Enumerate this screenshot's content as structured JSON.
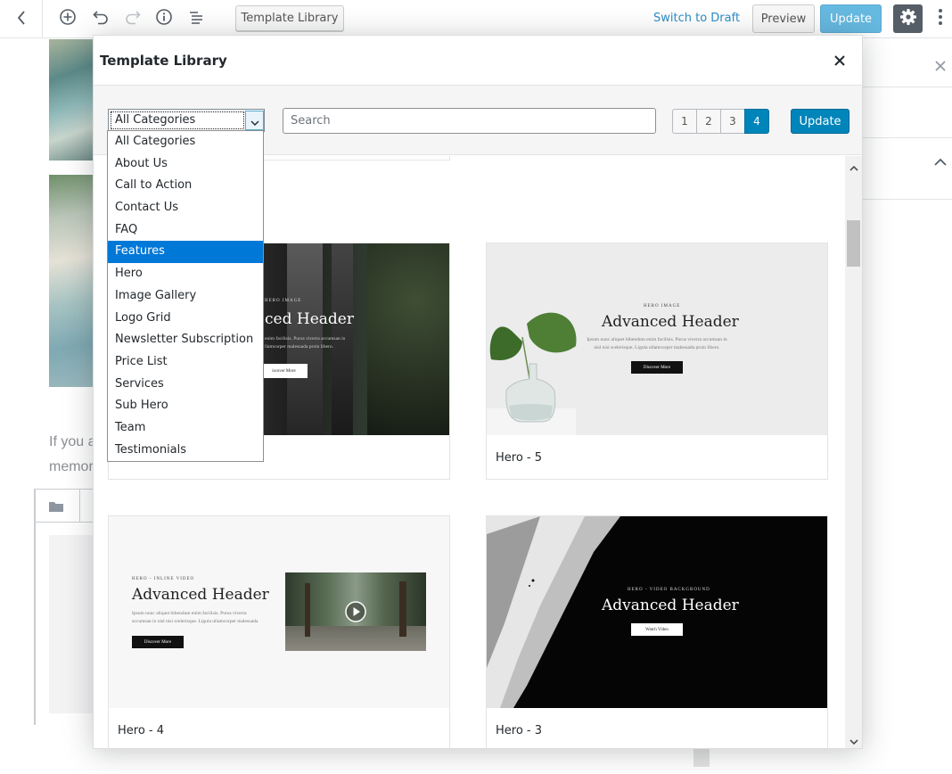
{
  "toolbar": {
    "template_library_label": "Template Library",
    "switch_to_draft_label": "Switch to Draft",
    "preview_label": "Preview",
    "update_label": "Update"
  },
  "background": {
    "paragraph_line1": "If you a",
    "paragraph_line2": "memor"
  },
  "modal": {
    "title": "Template Library",
    "category_select": {
      "value": "All Categories",
      "options": [
        "All Categories",
        "About Us",
        "Call to Action",
        "Contact Us",
        "FAQ",
        "Features",
        "Hero",
        "Image Gallery",
        "Logo Grid",
        "Newsletter Subscription",
        "Price List",
        "Services",
        "Sub Hero",
        "Team",
        "Testimonials"
      ],
      "highlighted": "Features"
    },
    "search_placeholder": "Search",
    "pages": [
      "1",
      "2",
      "3",
      "4"
    ],
    "active_page": "4",
    "update_label": "Update",
    "templates": [
      {
        "label": "",
        "thumb": {
          "kicker": "HERO IMAGE",
          "heading": "ced Header",
          "body_line1": "enim facilisis. Purus viverra accumsan in",
          "body_line2": "llamcorper malesuada proin libero.",
          "button": "iscover More"
        }
      },
      {
        "label": "Hero - 5",
        "thumb": {
          "kicker": "HERO IMAGE",
          "heading": "Advanced Header",
          "body_line1": "Ipsum nunc aliquet bibendum enim facilisis. Purus viverra accumsan in",
          "body_line2": "nisl nisi scelerisque. Ligula ullamcorper malesuada proin libero.",
          "button": "Discover More"
        }
      },
      {
        "label": "Hero - 4",
        "thumb": {
          "kicker": "HERO - INLINE VIDEO",
          "heading": "Advanced Header",
          "body_line1": "Ipsum nunc aliquet bibendum enim facilisis. Purus viverra",
          "body_line2": "accumsan in nisl nisi scelerisque. Ligula ullamcorper malesuada",
          "button": "Discover More"
        }
      },
      {
        "label": "Hero - 3",
        "thumb": {
          "kicker": "HERO - VIDEO BACKGROUND",
          "heading": "Advanced Header",
          "button": "Watch Video"
        }
      }
    ]
  },
  "colors": {
    "primary_button": "#0085ba",
    "dropdown_highlight": "#0078d7",
    "toolbar_update": "#66b9e0"
  }
}
